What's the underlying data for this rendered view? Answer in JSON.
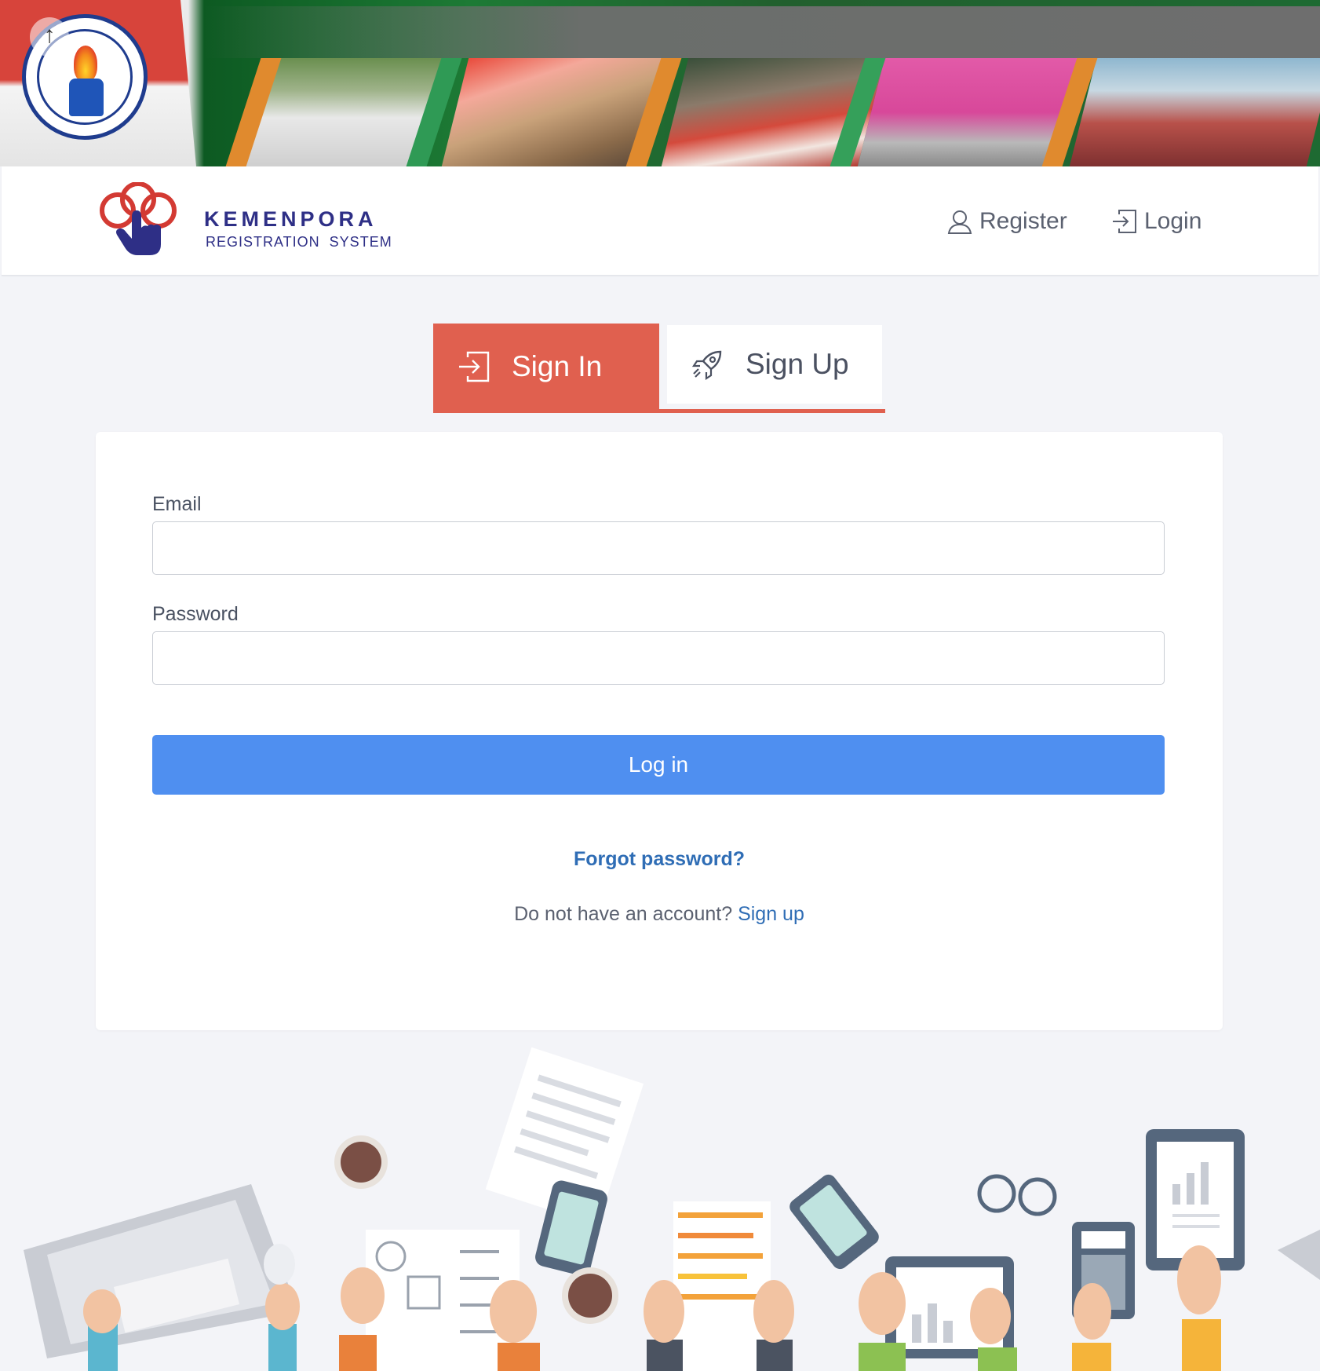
{
  "banner": {
    "scroll_top_icon": "arrow-up-icon"
  },
  "navbar": {
    "brand_title": "KEMENPORA",
    "brand_subtitle": "REGISTRATION  SYSTEM",
    "register_label": "Register",
    "login_label": "Login",
    "register_icon": "user-icon",
    "login_icon": "sign-in-icon"
  },
  "tabs": {
    "signin_label": "Sign In",
    "signup_label": "Sign Up",
    "active": "Sign In",
    "signin_icon": "sign-in-icon",
    "signup_icon": "rocket-icon"
  },
  "form": {
    "email_label": "Email",
    "email_value": "",
    "password_label": "Password",
    "password_value": "",
    "submit_label": "Log in",
    "forgot_label": "Forgot password?",
    "no_account_text": "Do not have an account?",
    "signup_link_label": "Sign up"
  },
  "colors": {
    "accent_red": "#e0604f",
    "button_blue": "#4f8ff0",
    "link_blue": "#2f6db5",
    "brand_navy": "#2e2f86",
    "page_bg": "#f3f4f8"
  }
}
